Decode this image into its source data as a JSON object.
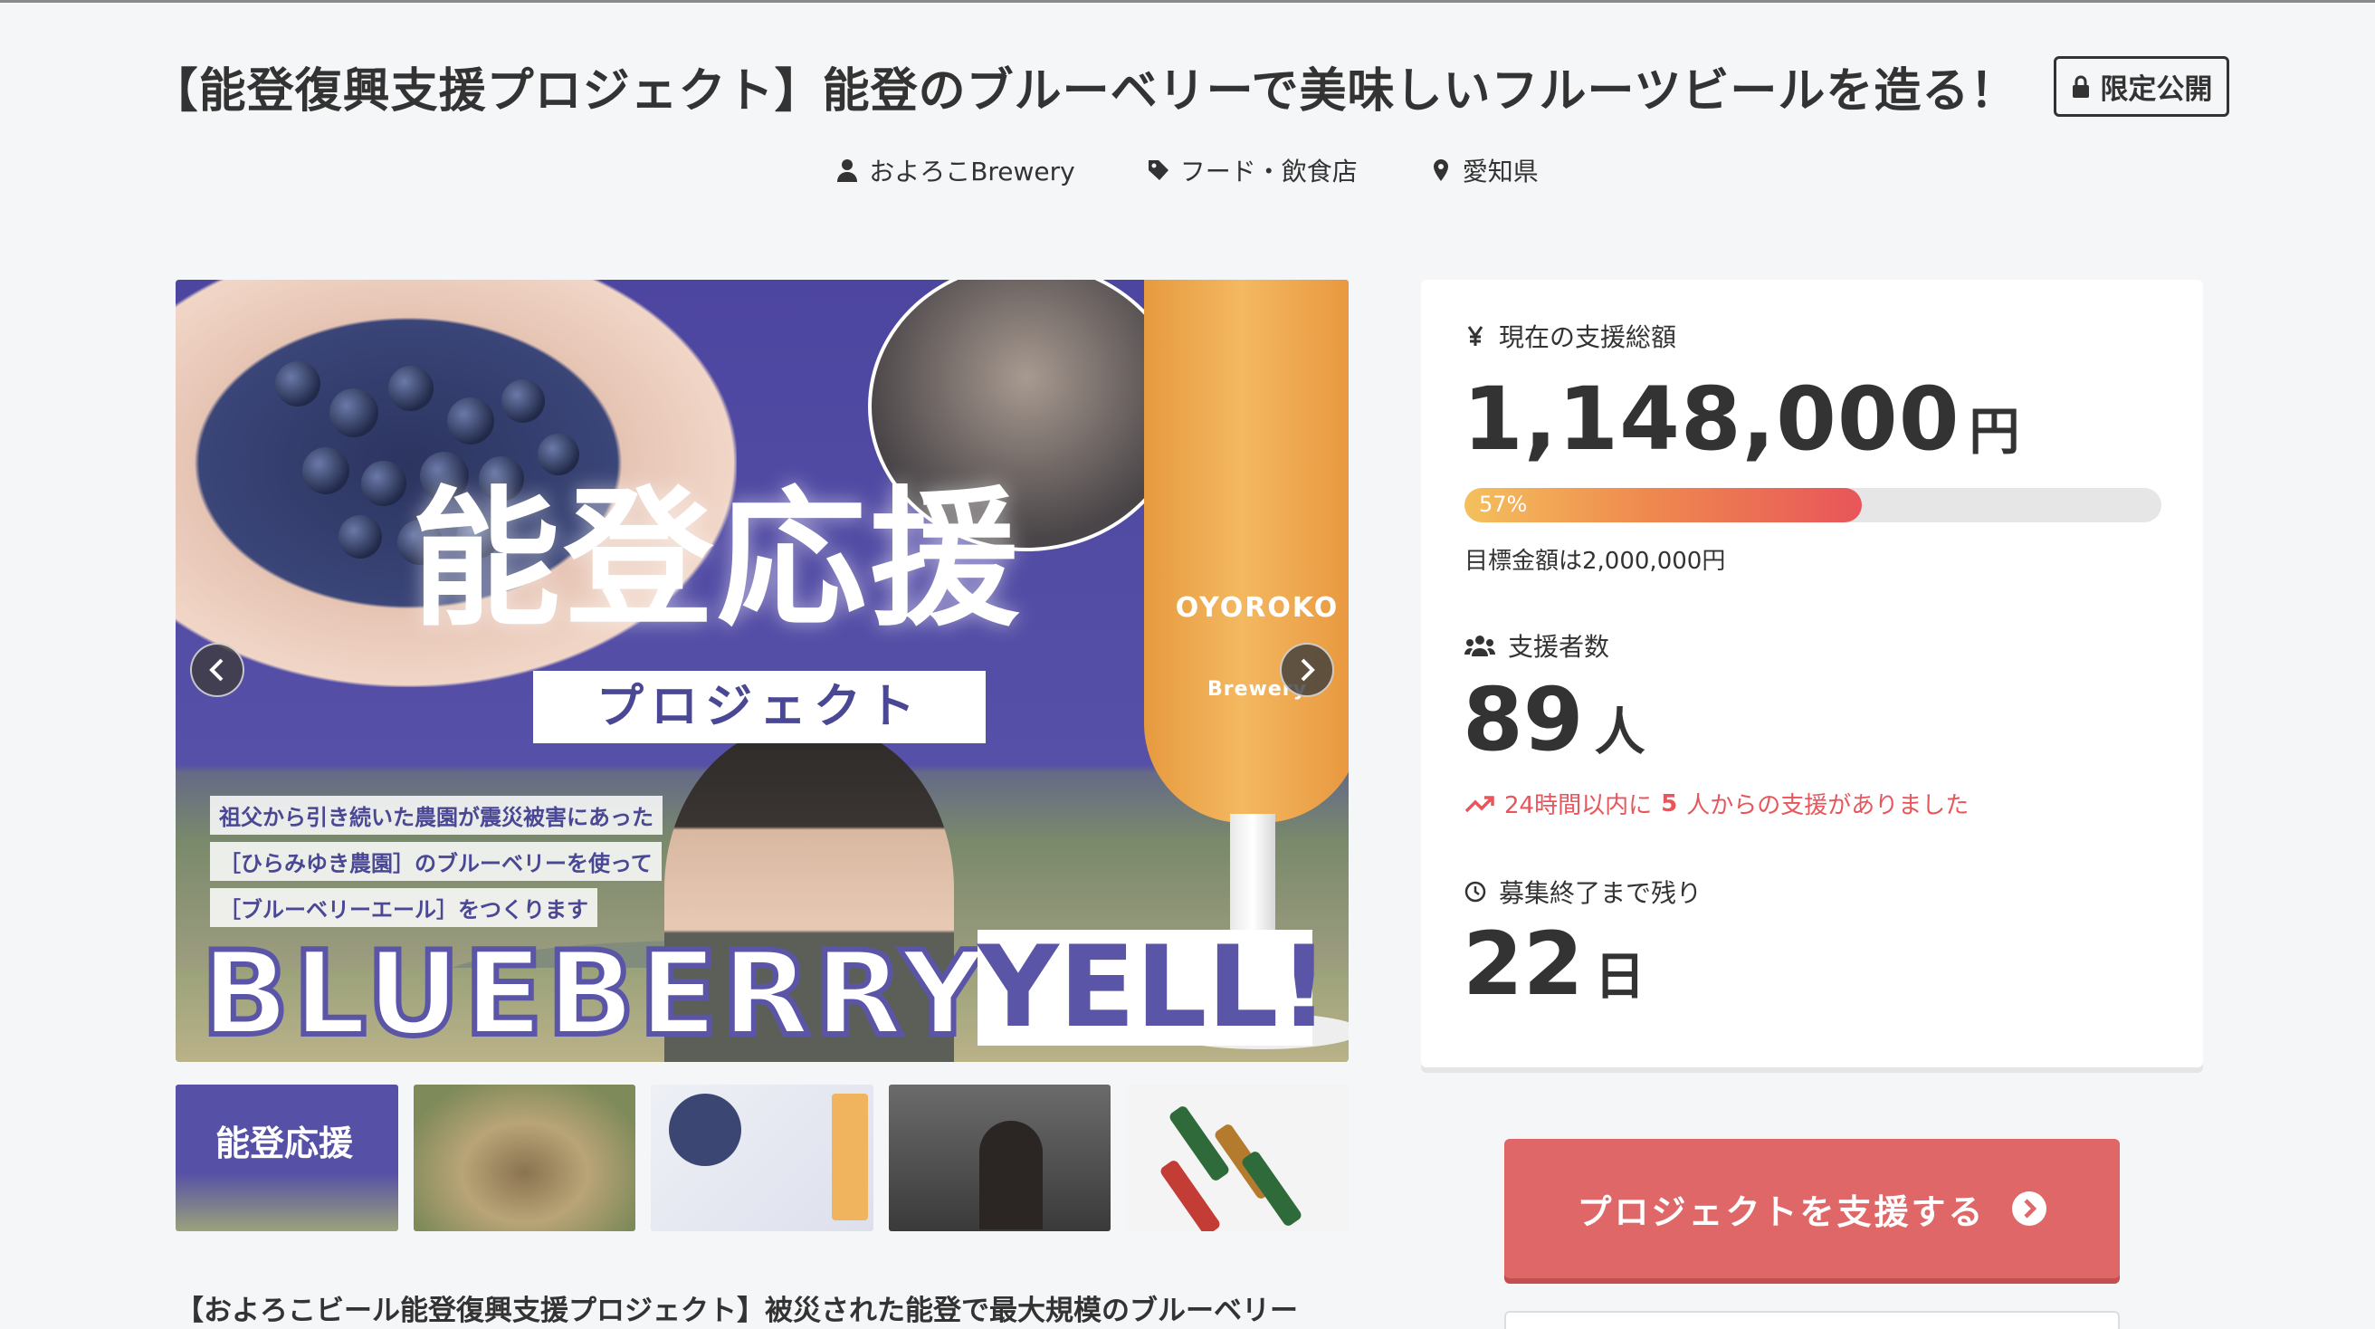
{
  "header": {
    "title": "【能登復興支援プロジェクト】能登のブルーベリーで美味しいフルーツビールを造る！",
    "badge": "限定公開",
    "owner": "およろこBrewery",
    "category": "フード・飲食店",
    "location": "愛知県"
  },
  "hero": {
    "big_title": "能登応援",
    "subtitle": "プロジェクト",
    "lines": [
      "祖父から引き続いた農園が震災被害にあった",
      "［ひらみゆき農園］のブルーベリーを使って",
      "［ブルーベリーエール］をつくります"
    ],
    "word1": "BLUEBERRY",
    "word2": "YELL!",
    "brand_top": "OYOROKO",
    "brand_bottom": "Brewery",
    "thumb1_text": "能登応援"
  },
  "description": "【およろこビール能登復興支援プロジェクト】被災された能登で最大規模のブルーベリー",
  "stats": {
    "total_label": "現在の支援総額",
    "total_value": "1,148,000",
    "total_unit": "円",
    "progress_percent": 57,
    "progress_text": "57%",
    "goal": "目標金額は2,000,000円",
    "supporters_label": "支援者数",
    "supporters_value": "89",
    "supporters_unit": "人",
    "trend_prefix": "24時間以内に",
    "trend_count": "5",
    "trend_suffix": "人からの支援がありました",
    "remaining_label": "募集終了まで残り",
    "remaining_value": "22",
    "remaining_unit": "日"
  },
  "cta": {
    "label": "プロジェクトを支援する"
  },
  "colors": {
    "accent": "#e06767",
    "trend": "#e8555a",
    "hero_purple": "#5b55a8"
  }
}
